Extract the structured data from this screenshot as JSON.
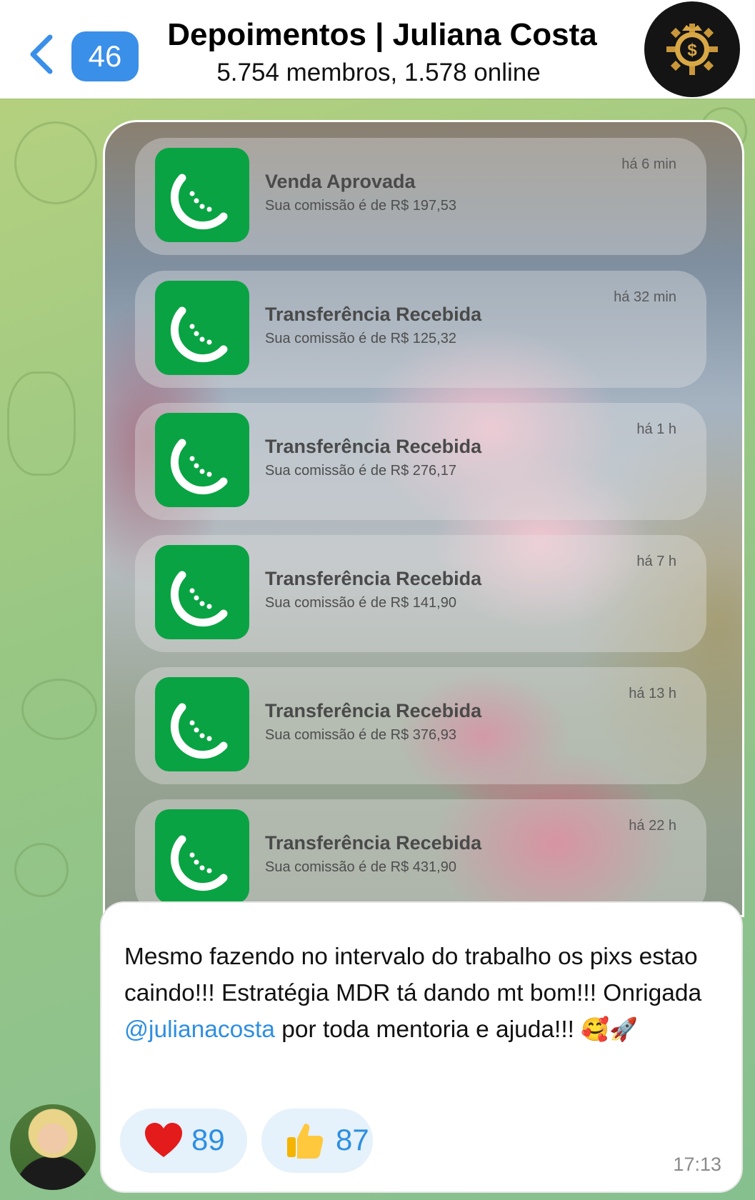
{
  "header": {
    "back_label": "",
    "unread_count": "46",
    "title": "Depoimentos | Juliana Costa",
    "subtitle": "5.754 membros, 1.578 online"
  },
  "notifications": [
    {
      "title": "Venda Aprovada",
      "text": "Sua comissão é de R$ 197,53",
      "time": "há 6 min"
    },
    {
      "title": "Transferência Recebida",
      "text": "Sua comissão é de R$ 125,32",
      "time": "há 32 min"
    },
    {
      "title": "Transferência Recebida",
      "text": "Sua comissão é de R$ 276,17",
      "time": "há 1 h"
    },
    {
      "title": "Transferência Recebida",
      "text": "Sua comissão é de R$ 141,90",
      "time": "há 7 h"
    },
    {
      "title": "Transferência Recebida",
      "text": "Sua comissão é de R$ 376,93",
      "time": "há 13 h"
    },
    {
      "title": "Transferência Recebida",
      "text": "Sua comissão é de R$ 431,90",
      "time": "há 22 h"
    }
  ],
  "message": {
    "text_before_mention": "Mesmo fazendo no intervalo do trabalho os pixs estao caindo!!! Estratégia MDR tá dando mt bom!!! Onrigada ",
    "mention": "@julianacosta",
    "text_after_mention": " por toda mentoria e ajuda!!! ",
    "emojis": "🥰🚀",
    "time": "17:13"
  },
  "reactions": [
    {
      "icon": "heart-icon",
      "count": "89"
    },
    {
      "icon": "thumbs-up-icon",
      "count": "87"
    }
  ],
  "colors": {
    "accent": "#2d8fe0",
    "badge": "#3a8fe8",
    "app_icon": "#0aa343"
  }
}
